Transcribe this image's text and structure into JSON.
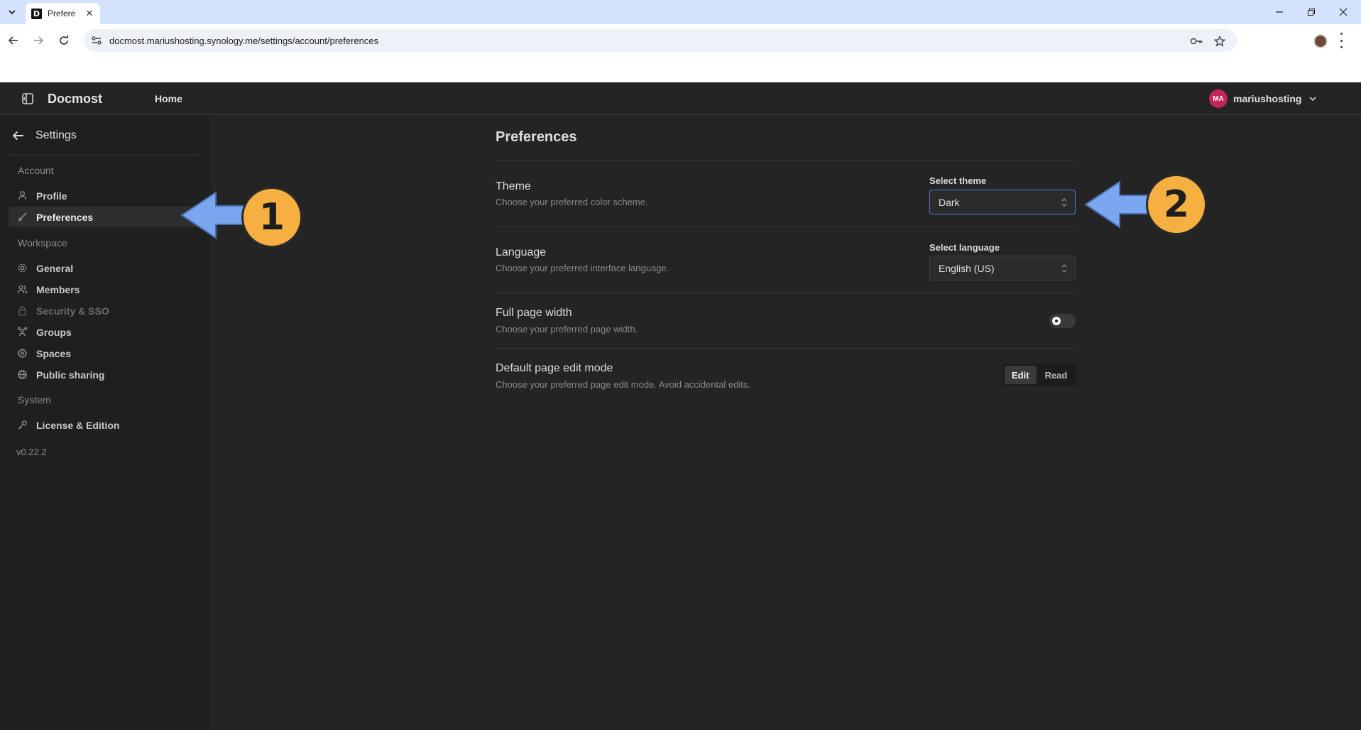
{
  "browser": {
    "tab_title": "Prefere",
    "favicon_letter": "D",
    "url": "docmost.mariushosting.synology.me/settings/account/preferences"
  },
  "header": {
    "brand": "Docmost",
    "home": "Home",
    "avatar_initials": "MA",
    "username": "mariushosting"
  },
  "sidebar": {
    "back_label": "Settings",
    "sections": {
      "account": "Account",
      "workspace": "Workspace",
      "system": "System"
    },
    "items": {
      "profile": "Profile",
      "preferences": "Preferences",
      "general": "General",
      "members": "Members",
      "security": "Security & SSO",
      "groups": "Groups",
      "spaces": "Spaces",
      "public_sharing": "Public sharing",
      "license": "License & Edition"
    },
    "version": "v0.22.2"
  },
  "main": {
    "title": "Preferences",
    "theme": {
      "label": "Theme",
      "description": "Choose your preferred color scheme.",
      "field_label": "Select theme",
      "value": "Dark"
    },
    "language": {
      "label": "Language",
      "description": "Choose your preferred interface language.",
      "field_label": "Select language",
      "value": "English (US)"
    },
    "full_width": {
      "label": "Full page width",
      "description": "Choose your preferred page width.",
      "enabled": false
    },
    "edit_mode": {
      "label": "Default page edit mode",
      "description": "Choose your preferred page edit mode. Avoid accidental edits.",
      "options": [
        "Edit",
        "Read"
      ],
      "selected": "Edit"
    }
  },
  "annotations": {
    "badge_1": "1",
    "badge_2": "2",
    "arrow_color": "#7ba7f0",
    "badge_color": "#f5b041"
  }
}
